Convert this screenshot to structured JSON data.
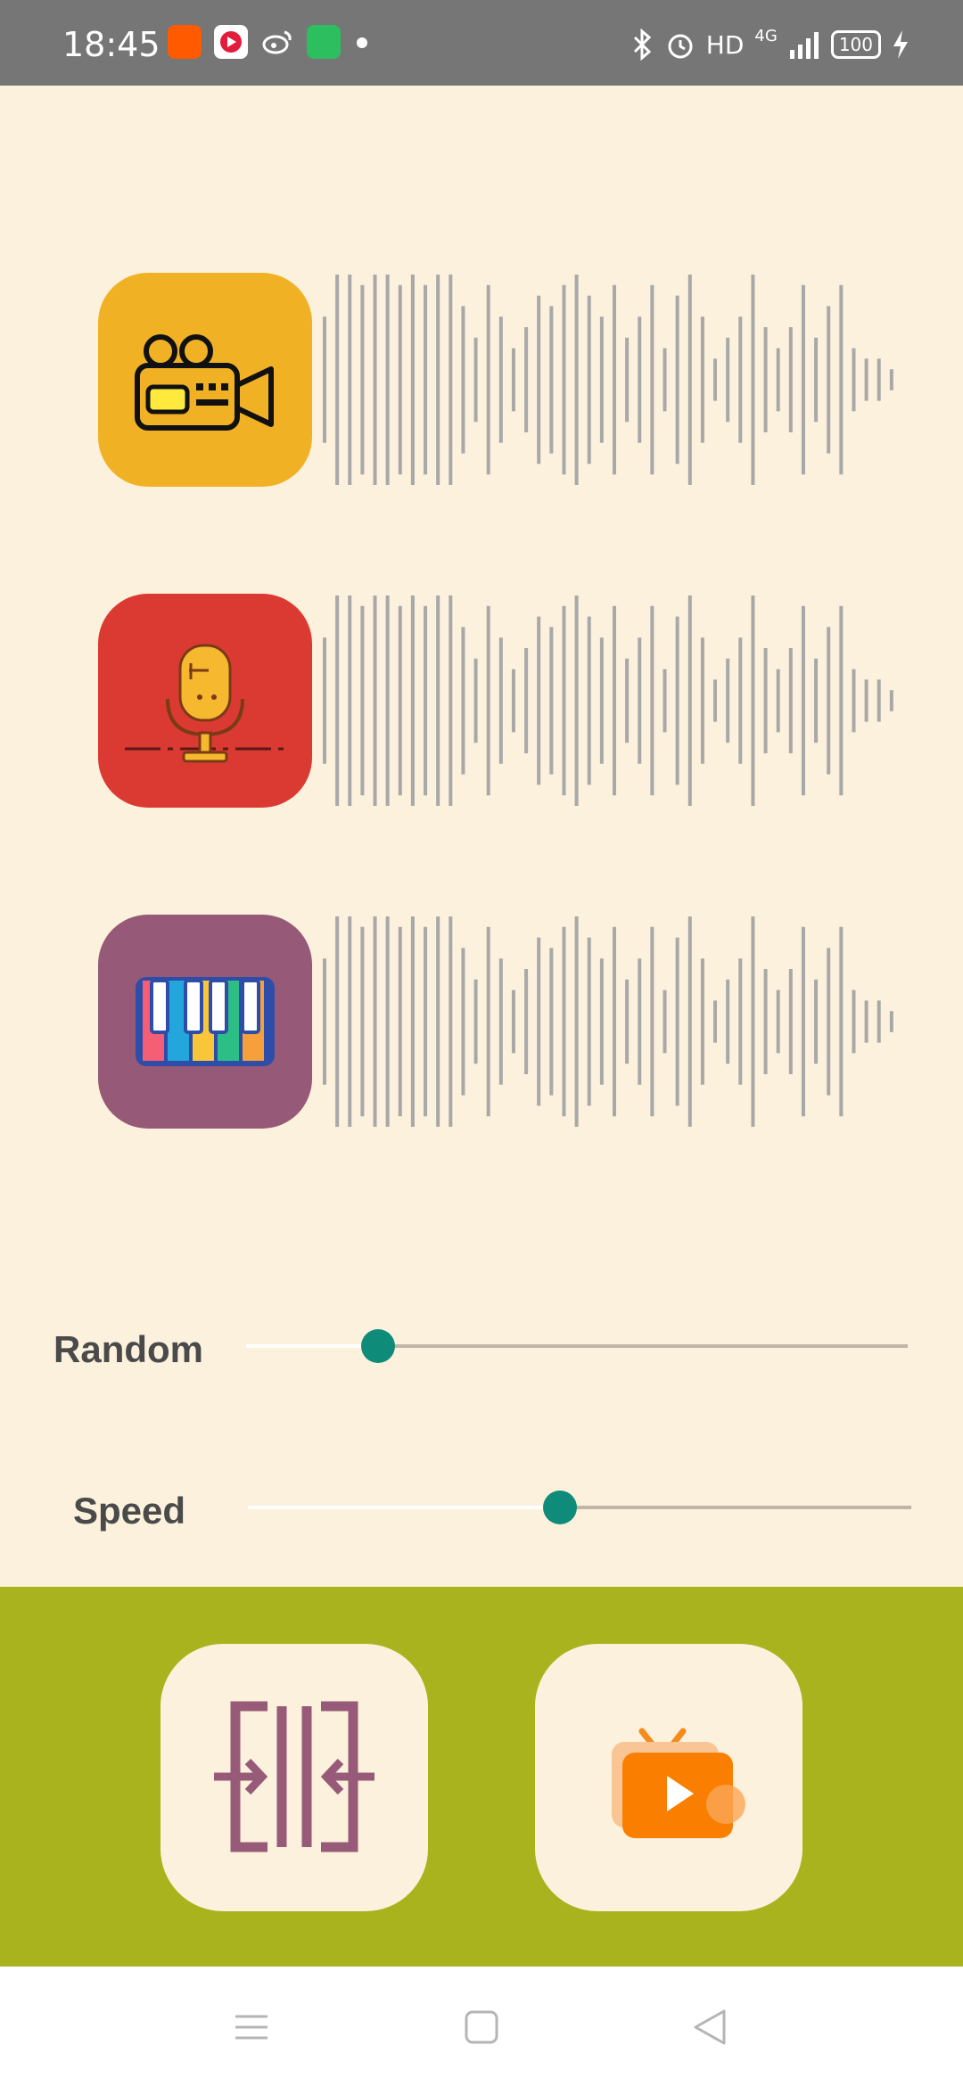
{
  "status_bar": {
    "time": "18:45",
    "network_label": "HD",
    "signal_label": "4G",
    "battery_level": "100",
    "notification_icons": [
      "taobao-icon",
      "video-app-icon",
      "weibo-icon",
      "green-app-icon"
    ]
  },
  "tracks": [
    {
      "name": "camera",
      "icon": "film-camera-icon",
      "color": "#F1B125"
    },
    {
      "name": "microphone",
      "icon": "microphone-icon",
      "color": "#DB3A33"
    },
    {
      "name": "piano",
      "icon": "piano-keys-icon",
      "color": "#965978"
    }
  ],
  "sliders": {
    "random": {
      "label": "Random",
      "value": 0.2
    },
    "speed": {
      "label": "Speed",
      "value": 0.47
    }
  },
  "actions": {
    "merge_icon": "merge-icon",
    "video_icon": "video-play-icon"
  },
  "colors": {
    "background": "#FCF1DD",
    "panel": "#A8B31E",
    "accent": "#0E8C79",
    "wave": "#A8A8A8"
  },
  "nav": [
    "menu-icon",
    "home-icon",
    "back-icon"
  ]
}
